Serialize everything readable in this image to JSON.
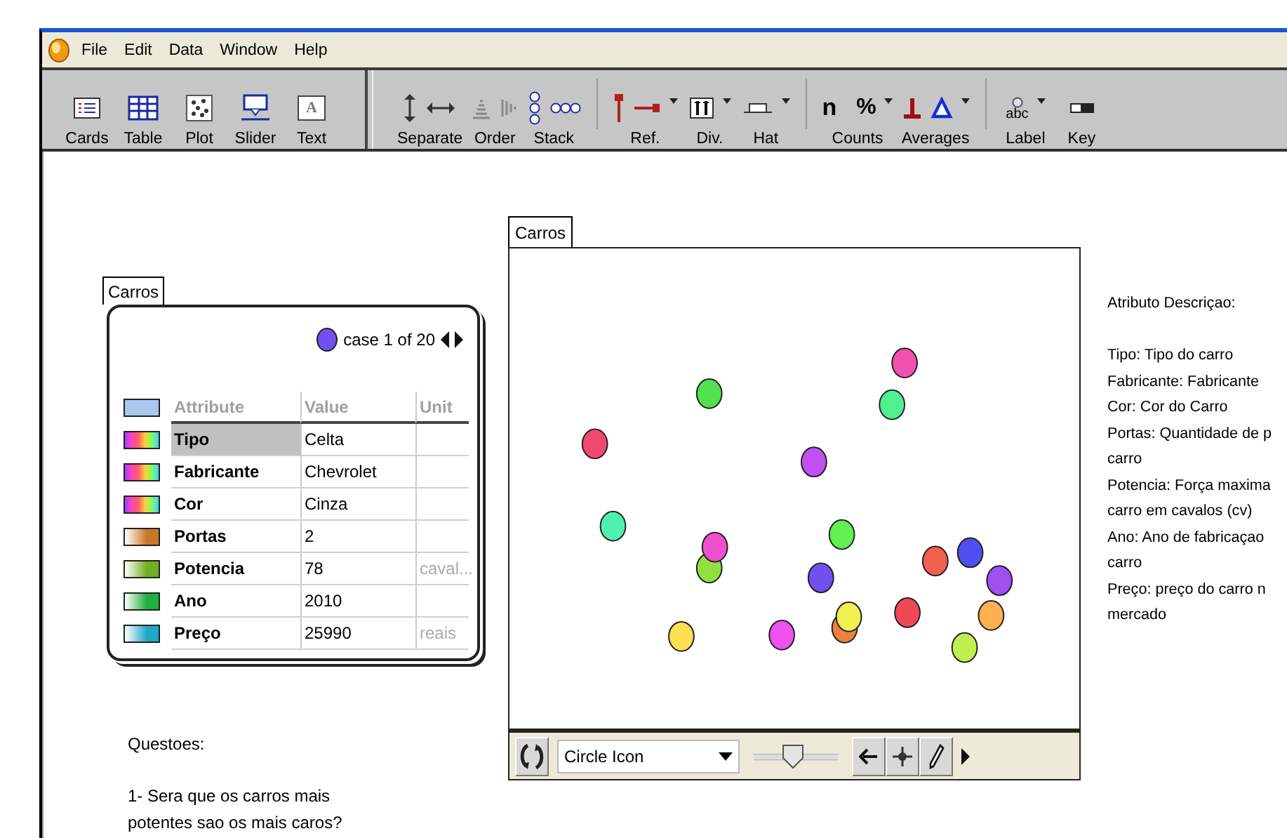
{
  "window": {
    "menu": [
      "File",
      "Edit",
      "Data",
      "Window",
      "Help"
    ]
  },
  "toolbar": {
    "groups": [
      {
        "tools": [
          {
            "kind": "cards",
            "label": "Cards"
          },
          {
            "kind": "table",
            "label": "Table"
          },
          {
            "kind": "plot",
            "label": "Plot"
          },
          {
            "kind": "slider",
            "label": "Slider"
          },
          {
            "kind": "text",
            "label": "Text",
            "glyph": "A"
          }
        ]
      },
      {
        "tools": [
          {
            "kind": "separate",
            "label": "Separate"
          },
          {
            "kind": "order",
            "label": "Order"
          },
          {
            "kind": "stack",
            "label": "Stack"
          }
        ]
      },
      {
        "tools": [
          {
            "kind": "reference",
            "label": "Ref."
          },
          {
            "kind": "divider",
            "label": "Div."
          },
          {
            "kind": "hat",
            "label": "Hat"
          }
        ]
      },
      {
        "tools": [
          {
            "kind": "counts",
            "label": "Counts",
            "glyphs": [
              "n",
              "%"
            ]
          },
          {
            "kind": "averages",
            "label": "Averages"
          }
        ]
      },
      {
        "tools": [
          {
            "kind": "label",
            "label": "Label",
            "glyph": "abc"
          },
          {
            "kind": "key",
            "label": "Key"
          }
        ]
      }
    ]
  },
  "card": {
    "title": "Carros",
    "case": {
      "text": "case 1 of 20",
      "color": "#7050f0"
    },
    "columns": [
      "Attribute",
      "Value",
      "Unit"
    ],
    "attributes": [
      {
        "name": "Tipo",
        "value": "Celta",
        "kind": "categorical",
        "selected": true
      },
      {
        "name": "Fabricante",
        "value": "Chevrolet",
        "kind": "categorical",
        "selected": false
      },
      {
        "name": "Cor",
        "value": "Cinza",
        "kind": "categorical",
        "selected": false
      },
      {
        "name": "Portas",
        "value": "2",
        "kind": "numeric",
        "color": "#c87828",
        "selected": false
      },
      {
        "name": "Potencia",
        "value": "78",
        "unit": "caval...",
        "kind": "numeric",
        "color": "#70b020",
        "selected": false
      },
      {
        "name": "Ano",
        "value": "2010",
        "kind": "numeric",
        "color": "#20b040",
        "selected": false
      },
      {
        "name": "Preço",
        "value": "25990",
        "unit": "reais",
        "kind": "numeric",
        "color": "#20a8c8",
        "selected": false
      }
    ]
  },
  "plot": {
    "title": "Carros",
    "toolbar": {
      "icon_menu": "Circle Icon",
      "slider": {
        "level": 0.46
      }
    }
  },
  "description": {
    "title": "Atributo Descriçao:",
    "lines": [
      "Tipo: Tipo do carro",
      "Fabricante: Fabricante",
      "Cor: Cor do Carro",
      "Portas: Quantidade de p",
      "carro",
      "Potencia: Força maxima",
      "carro em cavalos (cv)",
      "Ano: Ano de fabricaçao",
      "carro",
      "Preço: preço do carro n",
      "mercado"
    ]
  },
  "questions": {
    "title": "Questoes:",
    "items": [
      "1- Sera que os carros mais potentes sao os mais caros?"
    ]
  }
}
